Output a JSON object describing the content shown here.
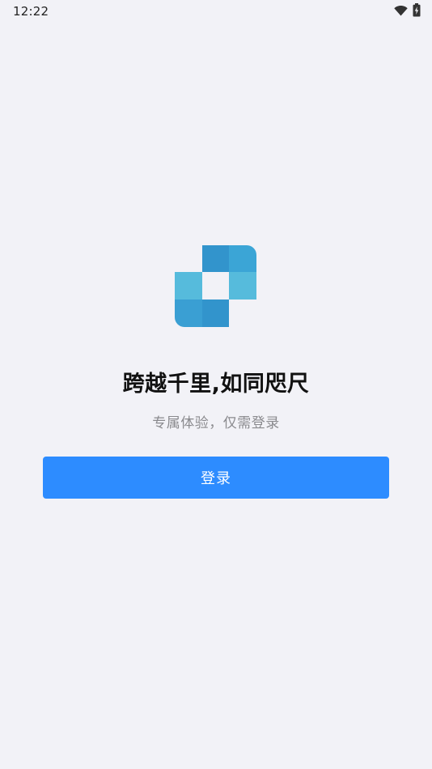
{
  "status_bar": {
    "time": "12:22",
    "icons": [
      "wifi-icon",
      "battery-charging-icon"
    ]
  },
  "logo": {
    "name": "app-logo",
    "colors": [
      "#3294cc",
      "#3ba5d6",
      "#56bbdc",
      "#3a9fd3"
    ]
  },
  "hero": {
    "title": "跨越千里,如同咫尺",
    "subtitle": "专属体验，仅需登录"
  },
  "actions": {
    "login_label": "登录"
  },
  "theme": {
    "background": "#f2f2f7",
    "accent": "#2d8cff",
    "subtitle_color": "#8a8a8e"
  }
}
